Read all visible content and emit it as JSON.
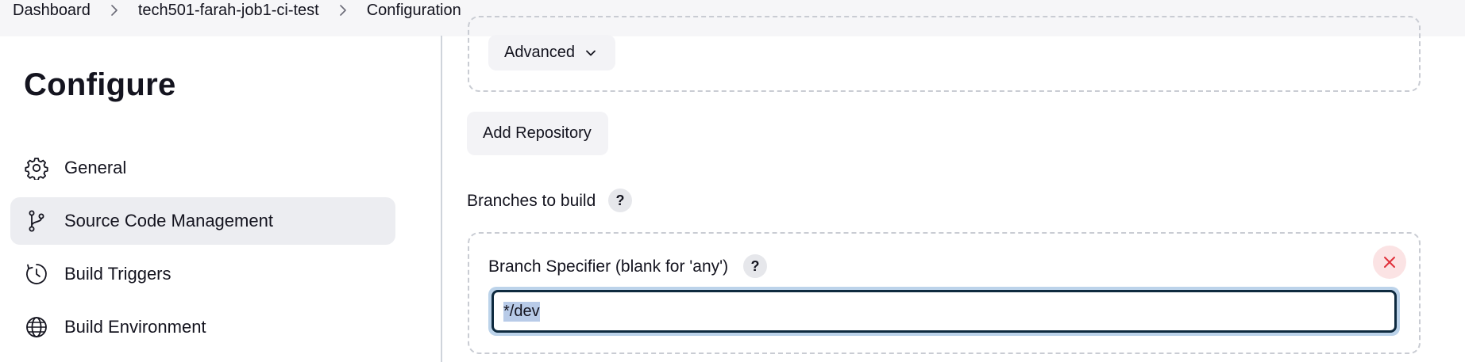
{
  "breadcrumb": {
    "items": [
      "Dashboard",
      "tech501-farah-job1-ci-test",
      "Configuration"
    ]
  },
  "sidebar": {
    "title": "Configure",
    "items": [
      {
        "label": "General",
        "icon": "gear-icon"
      },
      {
        "label": "Source Code Management",
        "icon": "branch-icon",
        "active": true
      },
      {
        "label": "Build Triggers",
        "icon": "clock-icon"
      },
      {
        "label": "Build Environment",
        "icon": "globe-icon"
      }
    ]
  },
  "main": {
    "advanced_label": "Advanced",
    "add_repository_label": "Add Repository",
    "branches_label": "Branches to build",
    "help_label": "?",
    "branch_specifier_label": "Branch Specifier (blank for 'any')",
    "branch_specifier_value": "*/dev"
  },
  "colors": {
    "accent_selection": "#b8cbe8",
    "focus_ring": "#bcd3ea",
    "active_nav_bg": "#ecedf1",
    "danger": "#e0303a"
  }
}
